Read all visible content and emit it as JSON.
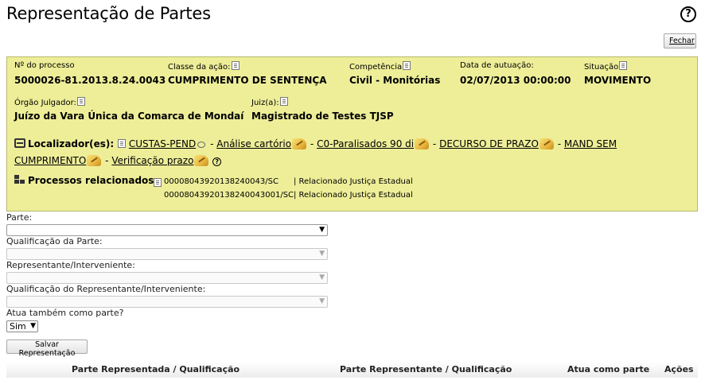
{
  "page": {
    "title": "Representação de Partes"
  },
  "toolbar": {
    "close_label": "Fechar",
    "help_icon": "question-circle-icon"
  },
  "process_info": {
    "numero": {
      "label": "Nº do processo",
      "value": "5000026-81.2013.8.24.0043"
    },
    "classe": {
      "label": "Classe da ação:",
      "value": "CUMPRIMENTO DE SENTENÇA"
    },
    "competencia": {
      "label": "Competência",
      "value": "Civil - Monitórias"
    },
    "data_autuacao": {
      "label": "Data de autuação:",
      "value": "02/07/2013 00:00:00"
    },
    "situacao": {
      "label": "Situação",
      "value": "MOVIMENTO"
    },
    "orgao": {
      "label": "Órgão Julgador:",
      "value": "Juízo da Vara Única da Comarca de Mondaí"
    },
    "juiz": {
      "label": "Juiz(a):",
      "value": "Magistrado de Testes TJSP"
    }
  },
  "localizadores": {
    "label": "Localizador(es):",
    "sep": "-",
    "items": [
      "CUSTAS-PEND",
      "Análise cartório",
      "C0-Paralisados 90 di",
      "DECURSO DE PRAZO",
      "MAND SEM",
      "CUMPRIMENTO",
      "Verificação prazo"
    ]
  },
  "relacionados": {
    "label": "Processos relacionados:",
    "items": [
      {
        "numero": "00008043920138240043/SC",
        "tipo": "| Relacionado Justiça Estadual"
      },
      {
        "numero": "00008043920138240043001/SC",
        "tipo": "| Relacionado Justiça Estadual"
      }
    ]
  },
  "form": {
    "parte_label": "Parte:",
    "qualificacao_parte_label": "Qualificação da Parte:",
    "representante_label": "Representante/Interveniente:",
    "qualificacao_representante_label": "Qualificação do Representante/Interveniente:",
    "atua_label": "Atua também como parte?",
    "atua_value": "Sim",
    "save_label": "Salvar Representação"
  },
  "table": {
    "columns": [
      "Parte Representada / Qualificação",
      "Parte Representante / Qualificação",
      "Atua como parte",
      "Ações"
    ]
  }
}
